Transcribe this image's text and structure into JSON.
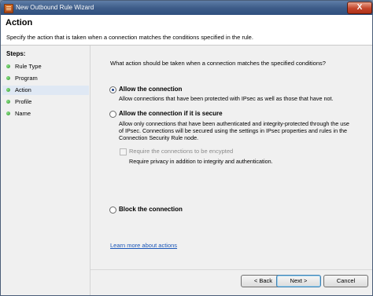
{
  "window": {
    "title": "New Outbound Rule Wizard",
    "close_label": "X"
  },
  "header": {
    "title": "Action",
    "description": "Specify the action that is taken when a connection matches the conditions specified in the rule."
  },
  "sidebar": {
    "steps_label": "Steps:",
    "current_step": "Action",
    "items": [
      {
        "label": "Rule Type"
      },
      {
        "label": "Program"
      },
      {
        "label": "Action"
      },
      {
        "label": "Profile"
      },
      {
        "label": "Name"
      }
    ]
  },
  "main": {
    "question": "What action should be taken when a connection matches the specified conditions?",
    "options": [
      {
        "title": "Allow the connection",
        "description": [
          "Allow connections that have been protected with IPsec as well as those that have not."
        ],
        "selected": true
      },
      {
        "title": "Allow the connection if it is secure",
        "description": [
          "Allow only connections that have been authenticated and integrity-protected through the use",
          "of IPsec.  Connections will be secured using the settings in IPsec properties and rules in the",
          "Connection Security Rule node."
        ],
        "selected": false
      },
      {
        "title": "Block the connection",
        "description": [],
        "selected": false
      }
    ],
    "encrypt_checkbox": {
      "label": "Require the connections to be encypted",
      "description": "Require privacy in addition to integrity and authentication.",
      "checked": false,
      "enabled": false
    },
    "learn_more_link": "Learn more about actions"
  },
  "footer": {
    "back_label": "< Back",
    "next_label": "Next >",
    "cancel_label": "Cancel"
  }
}
